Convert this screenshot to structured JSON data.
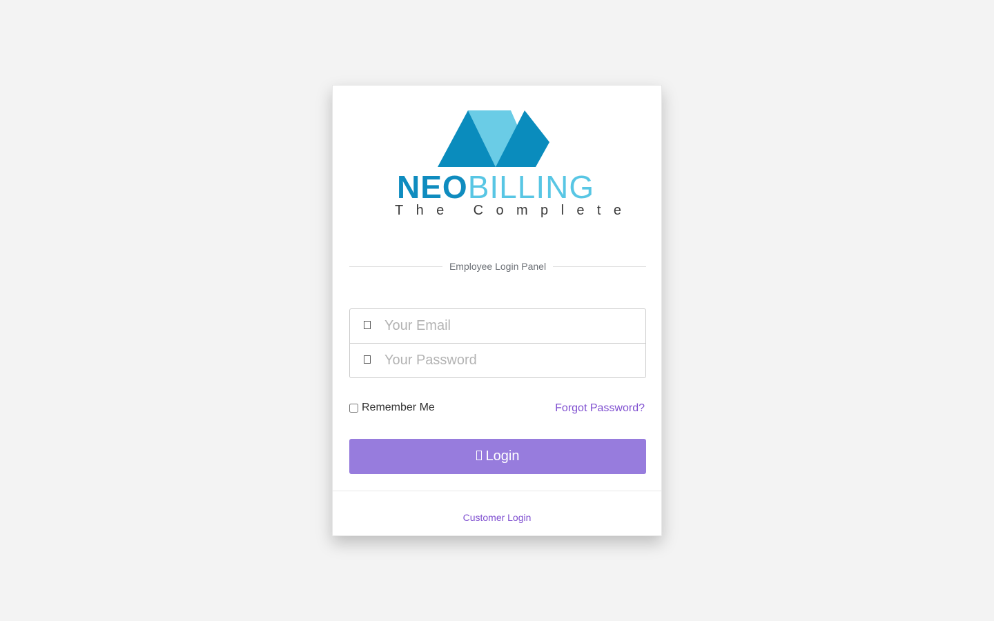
{
  "logo": {
    "brand_primary": "NEO",
    "brand_secondary": "BILLING",
    "tagline": "The Complete",
    "colors": {
      "dark_blue": "#0f8cbf",
      "light_blue": "#58c6e4"
    }
  },
  "panel": {
    "title": "Employee Login Panel"
  },
  "form": {
    "email": {
      "icon": "user-icon",
      "placeholder": "Your Email",
      "value": ""
    },
    "password": {
      "icon": "key-icon",
      "placeholder": "Your Password",
      "value": ""
    },
    "remember_label": "Remember Me",
    "forgot_label": "Forgot Password?",
    "login_label": "Login",
    "login_icon": "unlock-icon"
  },
  "footer": {
    "customer_link": "Customer Login"
  },
  "colors": {
    "accent": "#977cdd",
    "link": "#7f4fd0",
    "background": "#f3f3f3"
  }
}
